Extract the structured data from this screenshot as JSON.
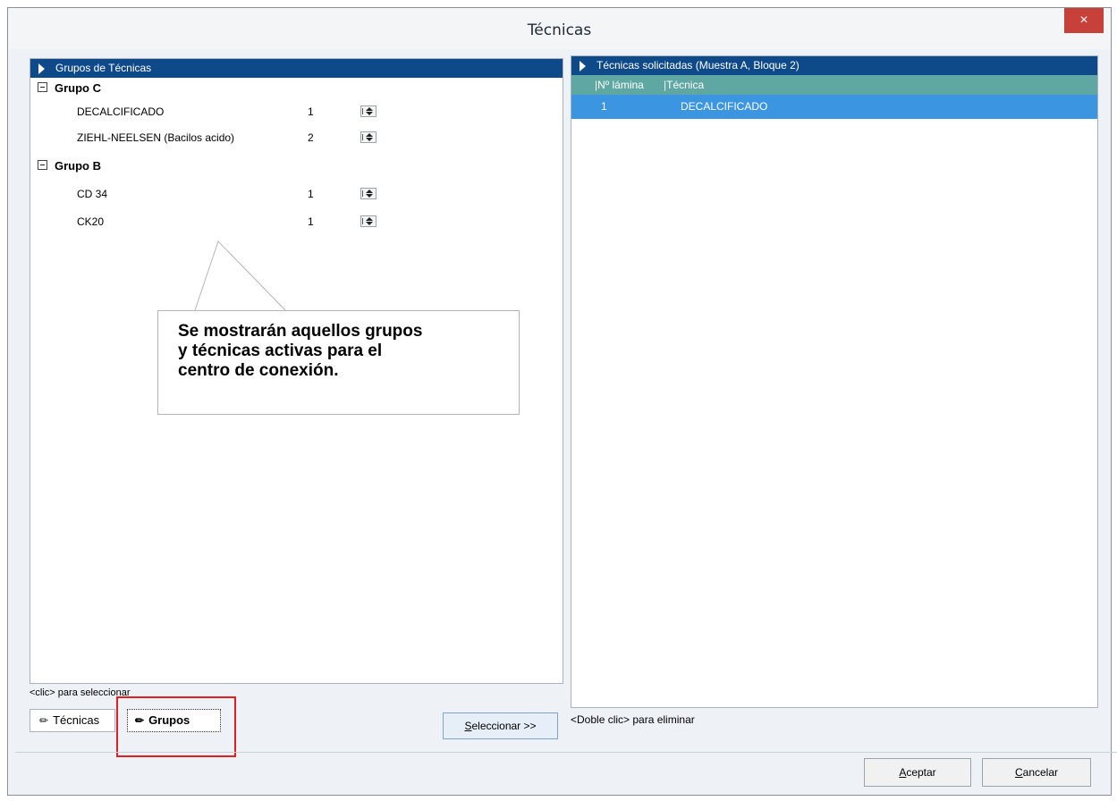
{
  "window": {
    "title": "Técnicas",
    "close_label": "×"
  },
  "left_panel": {
    "header": "Grupos de Técnicas",
    "groups": [
      {
        "name": "Grupo C",
        "items": [
          {
            "name": "DECALCIFICADO",
            "qty": "1"
          },
          {
            "name": "ZIEHL-NEELSEN (Bacilos acido)",
            "qty": "2"
          }
        ]
      },
      {
        "name": "Grupo B",
        "items": [
          {
            "name": "CD 34",
            "qty": "1"
          },
          {
            "name": "CK20",
            "qty": "1"
          }
        ]
      }
    ],
    "callout": {
      "line1": "Se mostrarán aquellos grupos",
      "line2": "y técnicas activas para el",
      "line3": "centro de conexión."
    },
    "hint": "<clic> para seleccionar"
  },
  "tabs": {
    "tecnicas": "Técnicas",
    "grupos": "Grupos"
  },
  "select_button": {
    "prefix": "S",
    "rest": "eleccionar  >>"
  },
  "right_panel": {
    "header": "Técnicas solicitadas (Muestra A, Bloque 2)",
    "columns": {
      "lamina": "|Nº lámina",
      "tecnica": "|Técnica"
    },
    "rows": [
      {
        "lamina": "1",
        "tecnica": "DECALCIFICADO"
      }
    ],
    "hint": "<Doble clic> para eliminar"
  },
  "buttons": {
    "accept_prefix": "A",
    "accept_rest": "ceptar",
    "cancel_prefix": "C",
    "cancel_rest": "ancelar"
  },
  "colors": {
    "panel_header": "#0e4a8a",
    "column_header": "#5ea7a3",
    "selected_row": "#3c95e0",
    "close_button": "#c7413a",
    "highlight_box": "#e02020"
  }
}
